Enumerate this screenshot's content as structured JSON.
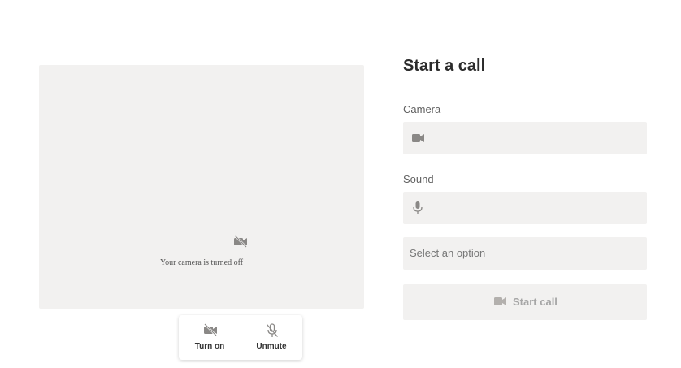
{
  "preview": {
    "camera_status_text": "Your camera is turned off",
    "controls": {
      "camera_label": "Turn on",
      "mic_label": "Unmute"
    }
  },
  "panel": {
    "title": "Start a call",
    "camera": {
      "label": "Camera",
      "icon": "video-camera-icon",
      "value": ""
    },
    "sound": {
      "label": "Sound",
      "icon": "microphone-icon",
      "value": ""
    },
    "option_select": {
      "placeholder": "Select an option"
    },
    "start_call_button": {
      "label": "Start call",
      "icon": "video-camera-icon",
      "enabled": false
    }
  },
  "colors": {
    "surface": "#f2f1f0",
    "icon_gray": "#8a8886",
    "disabled_text": "#a6a6a6",
    "title_text": "#2b2b2b"
  }
}
